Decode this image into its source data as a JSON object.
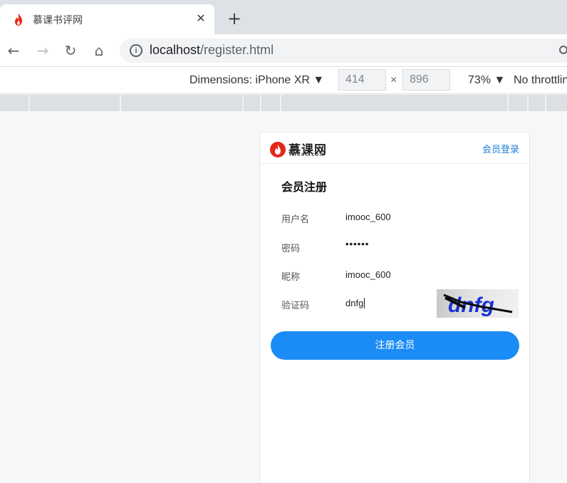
{
  "browser": {
    "tab_title": "慕课书评网",
    "tab_close": "✕",
    "new_tab": "+",
    "nav": {
      "back": "←",
      "forward": "→",
      "reload": "↻",
      "home": "⌂"
    },
    "url_host": "localhost",
    "url_path": "/register.html",
    "info_symbol": "i"
  },
  "device_toolbar": {
    "dimensions_label": "Dimensions: iPhone XR ▼",
    "width": "414",
    "height": "896",
    "times": "×",
    "zoom": "73% ▼",
    "throttling": "No throttling"
  },
  "site": {
    "logo_text": "慕课网",
    "logo_sub": "imooc.com",
    "login_link": "会员登录",
    "heading": "会员注册",
    "fields": {
      "username": {
        "label": "用户名",
        "value": "imooc_600"
      },
      "password": {
        "label": "密码",
        "value": "••••••"
      },
      "nickname": {
        "label": "昵称",
        "value": "imooc_600"
      },
      "captcha": {
        "label": "验证码",
        "value": "dnfg",
        "image_text": "dnfg"
      }
    },
    "submit": "注册会员"
  },
  "colors": {
    "brand_red": "#e3281b",
    "primary_blue": "#1b8bf5",
    "link_blue": "#1e7fd6",
    "captcha_text": "#1a2fd6"
  },
  "icons": [
    "flame-icon",
    "close-icon",
    "plus-icon",
    "back-arrow-icon",
    "forward-arrow-icon",
    "reload-icon",
    "home-icon",
    "info-icon",
    "dropdown-triangle-icon"
  ]
}
